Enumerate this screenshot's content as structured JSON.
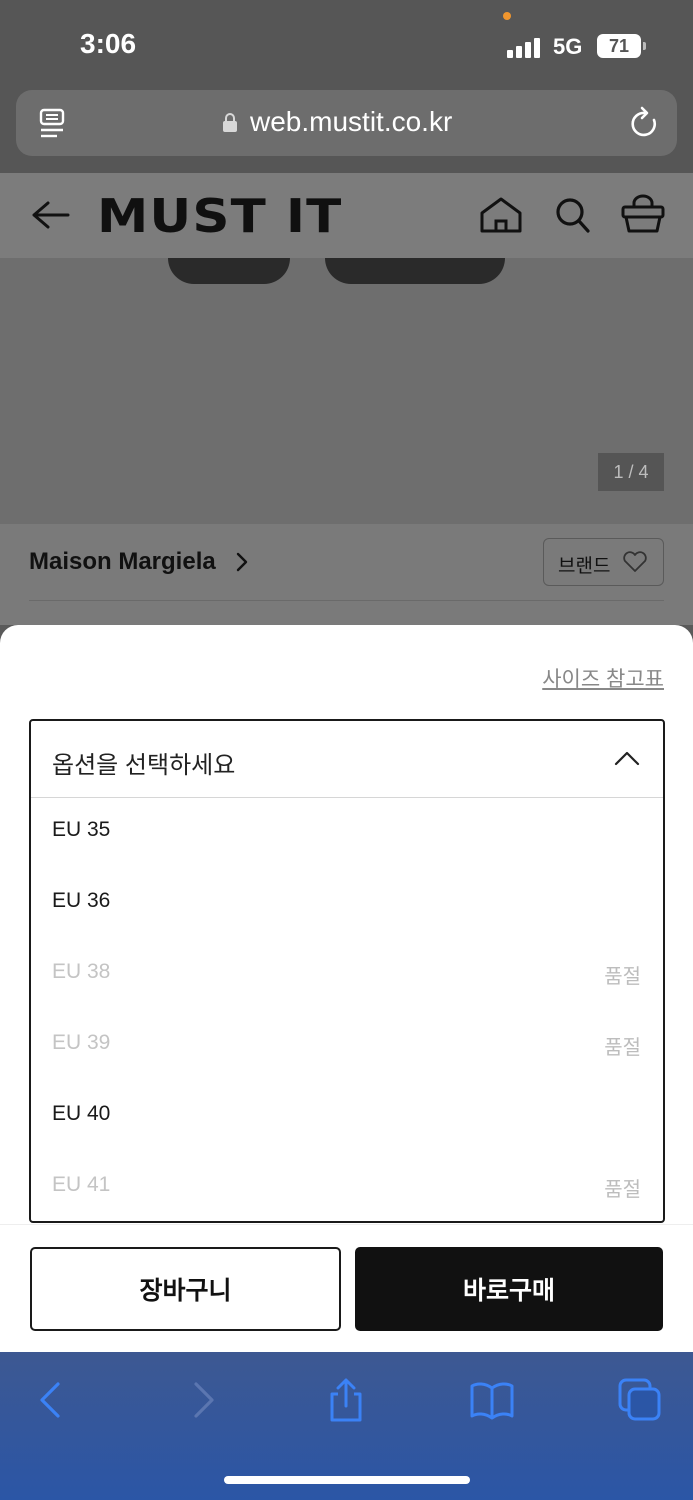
{
  "status_bar": {
    "time": "3:06",
    "network": "5G",
    "battery": "71",
    "colors": {
      "privacy_dot": "#f0962e"
    }
  },
  "browser": {
    "url": "web.mustit.co.kr",
    "icons": [
      "reader-icon",
      "lock-icon",
      "reload-icon"
    ]
  },
  "site_header": {
    "logo": "MUST IT",
    "icons": [
      "back-arrow-icon",
      "home-icon",
      "search-icon",
      "cart-icon"
    ]
  },
  "product": {
    "image_counter": "1 / 4",
    "brand_name": "Maison Margiela",
    "brand_like_label": "브랜드"
  },
  "option_sheet": {
    "size_guide": "사이즈 참고표",
    "select_placeholder": "옵션을 선택하세요",
    "options": [
      {
        "label": "EU 35",
        "status": ""
      },
      {
        "label": "EU 36",
        "status": ""
      },
      {
        "label": "EU 38",
        "status": "품절"
      },
      {
        "label": "EU 39",
        "status": "품절"
      },
      {
        "label": "EU 40",
        "status": ""
      },
      {
        "label": "EU 41",
        "status": "품절"
      }
    ]
  },
  "actions": {
    "cart_label": "장바구니",
    "buy_label": "바로구매"
  },
  "safari_toolbar": {
    "icons": [
      "back-icon",
      "forward-icon",
      "share-icon",
      "bookmarks-icon",
      "tabs-icon"
    ],
    "colors": {
      "icon": "#3b82f6",
      "disabled_icon": "#5b76b0"
    }
  }
}
